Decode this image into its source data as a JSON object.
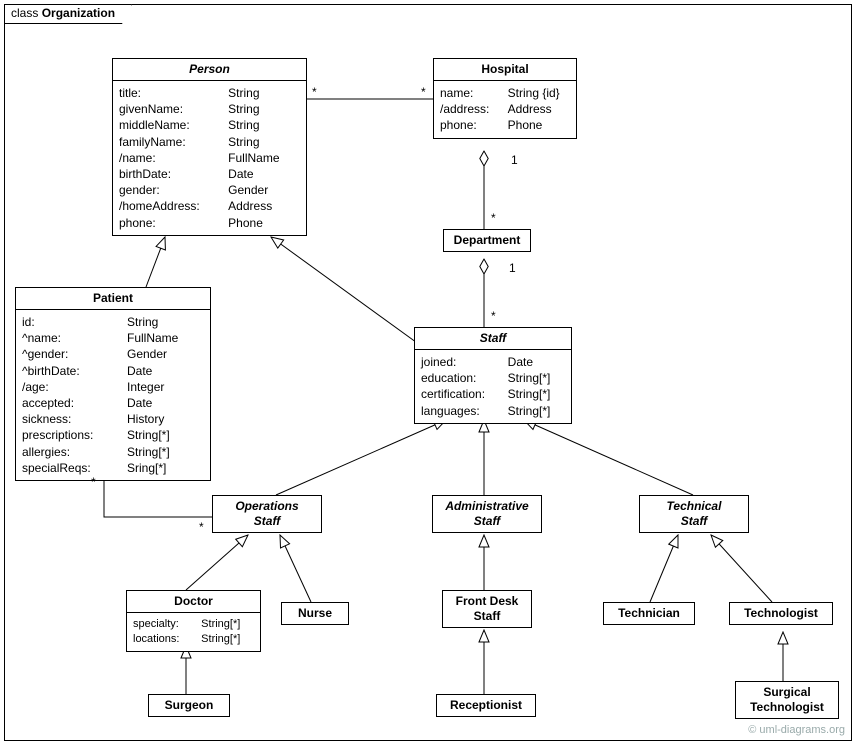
{
  "frame": {
    "label_prefix": "class",
    "label_bold": "Organization"
  },
  "watermark": "© uml-diagrams.org",
  "classes": {
    "person": {
      "title": "Person",
      "attrs": [
        [
          "title:",
          "String"
        ],
        [
          "givenName:",
          "String"
        ],
        [
          "middleName:",
          "String"
        ],
        [
          "familyName:",
          "String"
        ],
        [
          "/name:",
          "FullName"
        ],
        [
          "birthDate:",
          "Date"
        ],
        [
          "gender:",
          "Gender"
        ],
        [
          "/homeAddress:",
          "Address"
        ],
        [
          "phone:",
          "Phone"
        ]
      ]
    },
    "hospital": {
      "title": "Hospital",
      "attrs": [
        [
          "name:",
          "String {id}"
        ],
        [
          "/address:",
          "Address"
        ],
        [
          "phone:",
          "Phone"
        ]
      ]
    },
    "department": {
      "title": "Department"
    },
    "patient": {
      "title": "Patient",
      "attrs": [
        [
          "id:",
          "String"
        ],
        [
          "^name:",
          "FullName"
        ],
        [
          "^gender:",
          "Gender"
        ],
        [
          "^birthDate:",
          "Date"
        ],
        [
          "/age:",
          "Integer"
        ],
        [
          "accepted:",
          "Date"
        ],
        [
          "sickness:",
          "History"
        ],
        [
          "prescriptions:",
          "String[*]"
        ],
        [
          "allergies:",
          "String[*]"
        ],
        [
          "specialReqs:",
          "Sring[*]"
        ]
      ]
    },
    "staff": {
      "title": "Staff",
      "attrs": [
        [
          "joined:",
          "Date"
        ],
        [
          "education:",
          "String[*]"
        ],
        [
          "certification:",
          "String[*]"
        ],
        [
          "languages:",
          "String[*]"
        ]
      ]
    },
    "ops_staff": {
      "title": "Operations\nStaff"
    },
    "admin_staff": {
      "title": "Administrative\nStaff"
    },
    "tech_staff": {
      "title": "Technical\nStaff"
    },
    "doctor": {
      "title": "Doctor",
      "attrs": [
        [
          "specialty:",
          "String[*]"
        ],
        [
          "locations:",
          "String[*]"
        ]
      ]
    },
    "nurse": {
      "title": "Nurse"
    },
    "front_desk": {
      "title": "Front Desk\nStaff"
    },
    "technician": {
      "title": "Technician"
    },
    "technologist": {
      "title": "Technologist"
    },
    "surgeon": {
      "title": "Surgeon"
    },
    "receptionist": {
      "title": "Receptionist"
    },
    "surgical_tech": {
      "title": "Surgical\nTechnologist"
    }
  },
  "multiplicities": {
    "person_hospital_left": "*",
    "person_hospital_right": "*",
    "hospital_department_top": "1",
    "hospital_department_bottom": "*",
    "department_staff_top": "1",
    "department_staff_bottom": "*",
    "patient_ops_top": "*",
    "patient_ops_bottom": "*"
  }
}
